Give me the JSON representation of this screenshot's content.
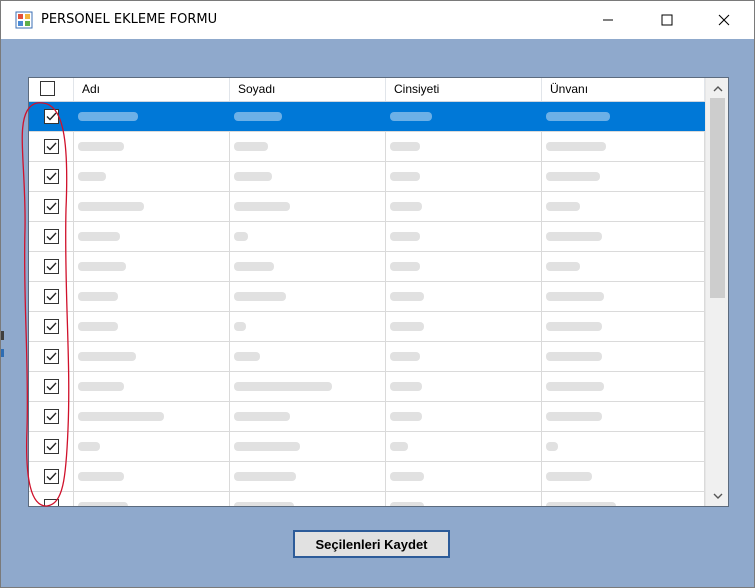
{
  "window": {
    "title": "PERSONEL EKLEME FORMU",
    "background": "#8fa9cc"
  },
  "grid": {
    "columns": [
      "Adı",
      "Soyadı",
      "Cinsiyeti",
      "Ünvanı"
    ],
    "header_select_all_checked": false,
    "selected_row_index": 0,
    "rows": [
      {
        "checked": true
      },
      {
        "checked": true
      },
      {
        "checked": true
      },
      {
        "checked": true
      },
      {
        "checked": true
      },
      {
        "checked": true
      },
      {
        "checked": true
      },
      {
        "checked": true
      },
      {
        "checked": true
      },
      {
        "checked": true
      },
      {
        "checked": true
      },
      {
        "checked": true
      },
      {
        "checked": true
      },
      {
        "checked": false
      }
    ]
  },
  "actions": {
    "save_label": "Seçilenleri Kaydet"
  },
  "colors": {
    "selection": "#0078d7",
    "annotation": "#d0112b",
    "button_border": "#2c5b99"
  }
}
